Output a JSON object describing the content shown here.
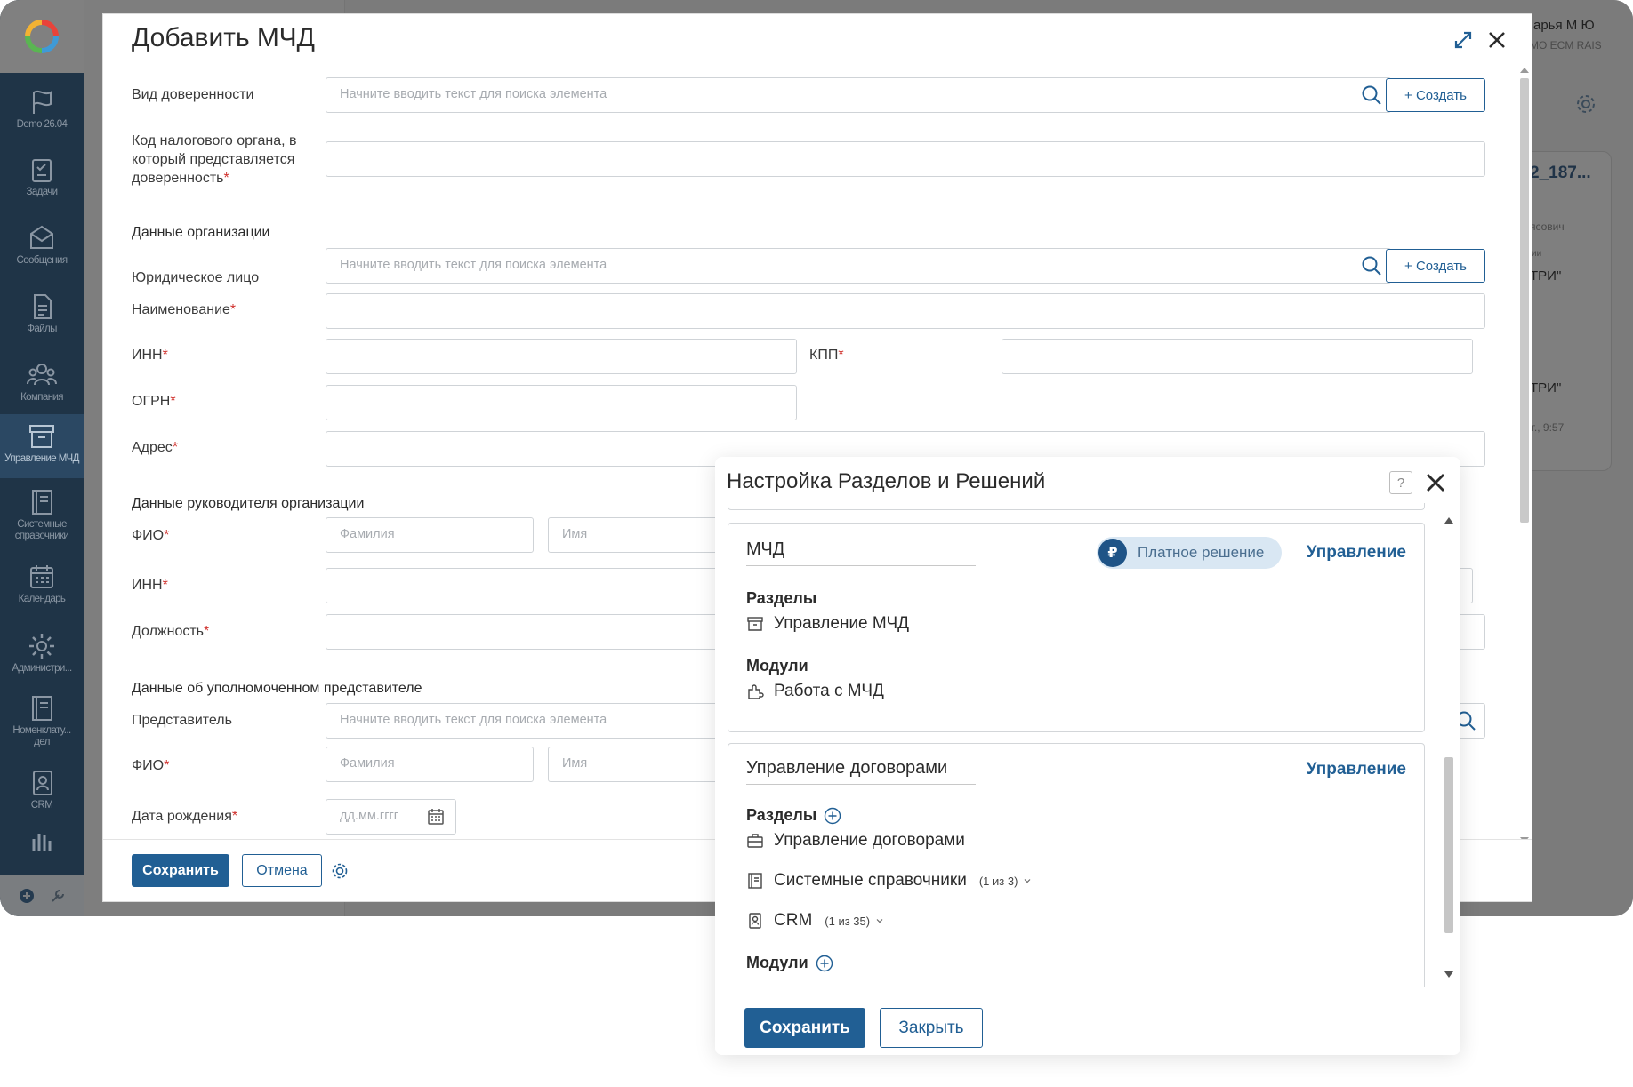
{
  "sidebar": {
    "items": [
      {
        "label": "Demo 26.04",
        "icon": "flag-icon"
      },
      {
        "label": "Задачи",
        "icon": "tasks-icon"
      },
      {
        "label": "Сообщения",
        "icon": "messages-icon"
      },
      {
        "label": "Файлы",
        "icon": "files-icon"
      },
      {
        "label": "Компания",
        "icon": "company-icon"
      },
      {
        "label": "Управление МЧД",
        "icon": "archive-icon"
      },
      {
        "label": "Системные справочники",
        "icon": "book-icon"
      },
      {
        "label": "Календарь",
        "icon": "calendar-icon"
      },
      {
        "label": "Администри...",
        "icon": "gear-icon"
      },
      {
        "label": "Номенклату... дел",
        "icon": "book-icon"
      },
      {
        "label": "CRM",
        "icon": "contact-icon"
      }
    ]
  },
  "background": {
    "user_name": "арья М Ю",
    "org_name": "МО ECM RAIS",
    "doc_id": "2_187...",
    "text1": "ясович",
    "text2": "ии",
    "text3": "ТРИ\"",
    "text4": "ТРИ\"",
    "time": "г., 9:57"
  },
  "mchd_form": {
    "title": "Добавить МЧД",
    "create_label": "+ Создать",
    "search_placeholder": "Начните вводить текст для поиска элемента",
    "fields": {
      "poa_type": "Вид доверенности",
      "tax_code": "Код налогового органа, в который представляется доверенность",
      "org_section": "Данные организации",
      "legal_entity": "Юридическое лицо",
      "name": "Наименование",
      "inn": "ИНН",
      "kpp": "КПП",
      "ogrn": "ОГРН",
      "address": "Адрес",
      "head_section": "Данные руководителя организации",
      "fio": "ФИО",
      "head_inn": "ИНН",
      "position": "Должность",
      "rep_section": "Данные об уполномоченном представителе",
      "representative": "Представитель",
      "rep_fio": "ФИО",
      "birth_date": "Дата рождения"
    },
    "placeholders": {
      "surname": "Фамилия",
      "first_name": "Имя",
      "date": "дд.мм.гггг"
    },
    "save_label": "Сохранить",
    "cancel_label": "Отмена"
  },
  "settings_popup": {
    "title": "Настройка Разделов и Решений",
    "help_icon": "?",
    "solutions": [
      {
        "name": "МЧД",
        "badge": "Платное решение",
        "badge_icon": "₽",
        "manage_label": "Управление",
        "sections_label": "Разделы",
        "sections": [
          {
            "label": "Управление МЧД"
          }
        ],
        "modules_label": "Модули",
        "modules": [
          {
            "label": "Работа с МЧД"
          }
        ]
      },
      {
        "name": "Управление договорами",
        "manage_label": "Управление",
        "sections_label": "Разделы",
        "sections": [
          {
            "label": "Управление договорами"
          },
          {
            "label": "Системные справочники",
            "count": "(1 из 3)"
          },
          {
            "label": "CRM",
            "count": "(1 из 35)"
          }
        ],
        "modules_label": "Модули"
      }
    ],
    "save_label": "Сохранить",
    "close_label": "Закрыть"
  },
  "colors": {
    "accent": "#215f94",
    "sidebar_bg": "#1f3447",
    "required_star": "#d0312d",
    "badge_bg": "#d9e7f3"
  }
}
